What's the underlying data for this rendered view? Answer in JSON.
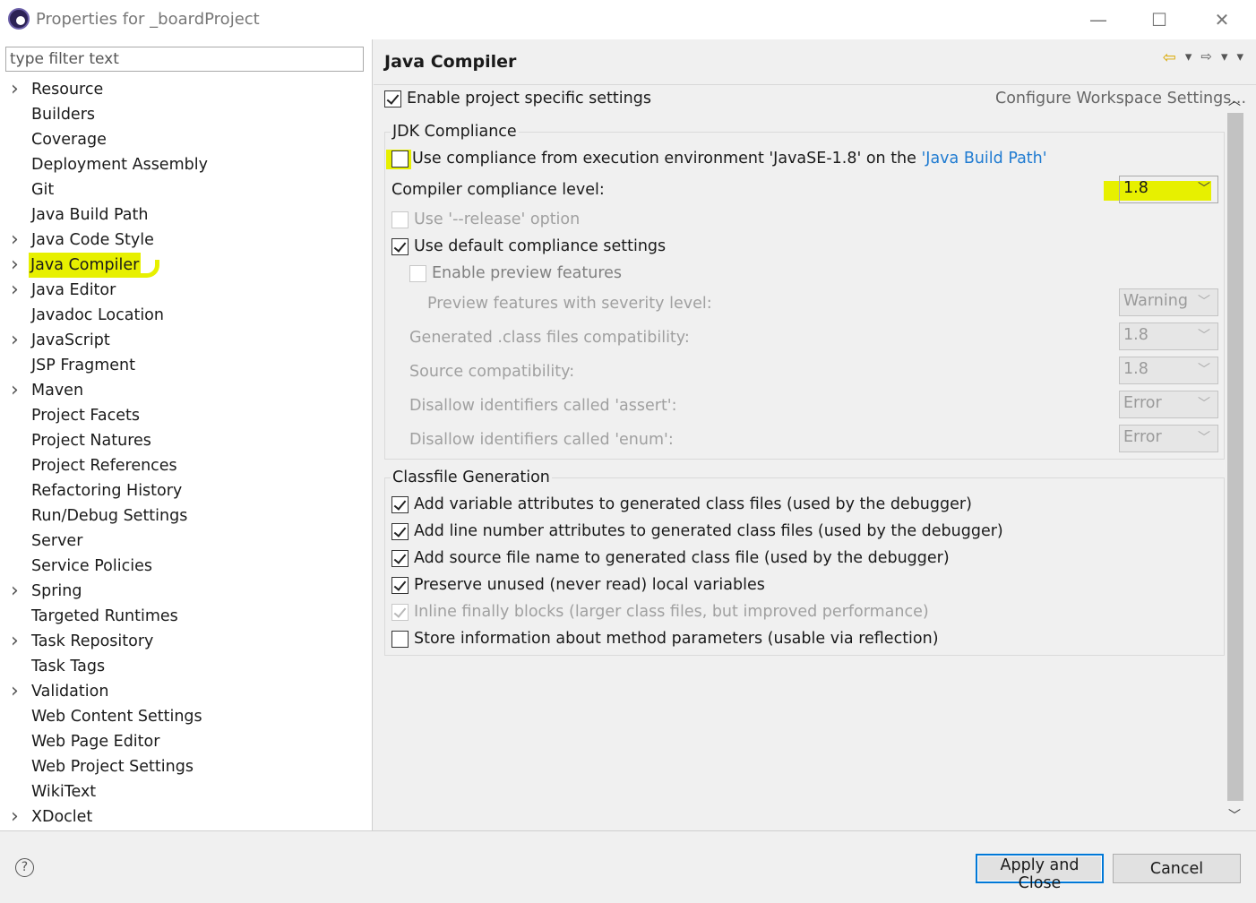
{
  "window": {
    "title": "Properties for _boardProject",
    "minimize": "—",
    "maximize": "☐",
    "close": "✕"
  },
  "filter": {
    "placeholder": "type filter text"
  },
  "tree": [
    {
      "label": "Resource",
      "expandable": true
    },
    {
      "label": "Builders",
      "expandable": false
    },
    {
      "label": "Coverage",
      "expandable": false
    },
    {
      "label": "Deployment Assembly",
      "expandable": false
    },
    {
      "label": "Git",
      "expandable": false
    },
    {
      "label": "Java Build Path",
      "expandable": false
    },
    {
      "label": "Java Code Style",
      "expandable": true
    },
    {
      "label": "Java Compiler",
      "expandable": true,
      "selected": true
    },
    {
      "label": "Java Editor",
      "expandable": true
    },
    {
      "label": "Javadoc Location",
      "expandable": false
    },
    {
      "label": "JavaScript",
      "expandable": true
    },
    {
      "label": "JSP Fragment",
      "expandable": false
    },
    {
      "label": "Maven",
      "expandable": true
    },
    {
      "label": "Project Facets",
      "expandable": false
    },
    {
      "label": "Project Natures",
      "expandable": false
    },
    {
      "label": "Project References",
      "expandable": false
    },
    {
      "label": "Refactoring History",
      "expandable": false
    },
    {
      "label": "Run/Debug Settings",
      "expandable": false
    },
    {
      "label": "Server",
      "expandable": false
    },
    {
      "label": "Service Policies",
      "expandable": false
    },
    {
      "label": "Spring",
      "expandable": true
    },
    {
      "label": "Targeted Runtimes",
      "expandable": false
    },
    {
      "label": "Task Repository",
      "expandable": true
    },
    {
      "label": "Task Tags",
      "expandable": false
    },
    {
      "label": "Validation",
      "expandable": true
    },
    {
      "label": "Web Content Settings",
      "expandable": false
    },
    {
      "label": "Web Page Editor",
      "expandable": false
    },
    {
      "label": "Web Project Settings",
      "expandable": false
    },
    {
      "label": "WikiText",
      "expandable": false
    },
    {
      "label": "XDoclet",
      "expandable": true
    }
  ],
  "page": {
    "title": "Java Compiler",
    "enable_specific": "Enable project specific settings",
    "configure_link": "Configure Workspace Settings...",
    "jdk": {
      "title": "JDK Compliance",
      "use_compliance_prefix": "Use compliance from execution environment 'JavaSE-1.8' on the ",
      "use_compliance_link": "'Java Build Path'",
      "compliance_level_label": "Compiler compliance level:",
      "compliance_level_value": "1.8",
      "release_option": "Use '--release' option",
      "default_compliance": "Use default compliance settings",
      "enable_preview": "Enable preview features",
      "preview_severity_label": "Preview features with severity level:",
      "preview_severity_value": "Warning",
      "generated_label": "Generated .class files compatibility:",
      "generated_value": "1.8",
      "source_label": "Source compatibility:",
      "source_value": "1.8",
      "assert_label": "Disallow identifiers called 'assert':",
      "assert_value": "Error",
      "enum_label": "Disallow identifiers called 'enum':",
      "enum_value": "Error"
    },
    "classfile": {
      "title": "Classfile Generation",
      "opt1": "Add variable attributes to generated class files (used by the debugger)",
      "opt2": "Add line number attributes to generated class files (used by the debugger)",
      "opt3": "Add source file name to generated class file (used by the debugger)",
      "opt4": "Preserve unused (never read) local variables",
      "opt5": "Inline finally blocks (larger class files, but improved performance)",
      "opt6": "Store information about method parameters (usable via reflection)"
    }
  },
  "buttons": {
    "help": "?",
    "apply_close": "Apply and Close",
    "cancel": "Cancel"
  },
  "colors": {
    "highlight": "#e7f000",
    "link": "#1f7bd1",
    "focus": "#0078d7"
  }
}
